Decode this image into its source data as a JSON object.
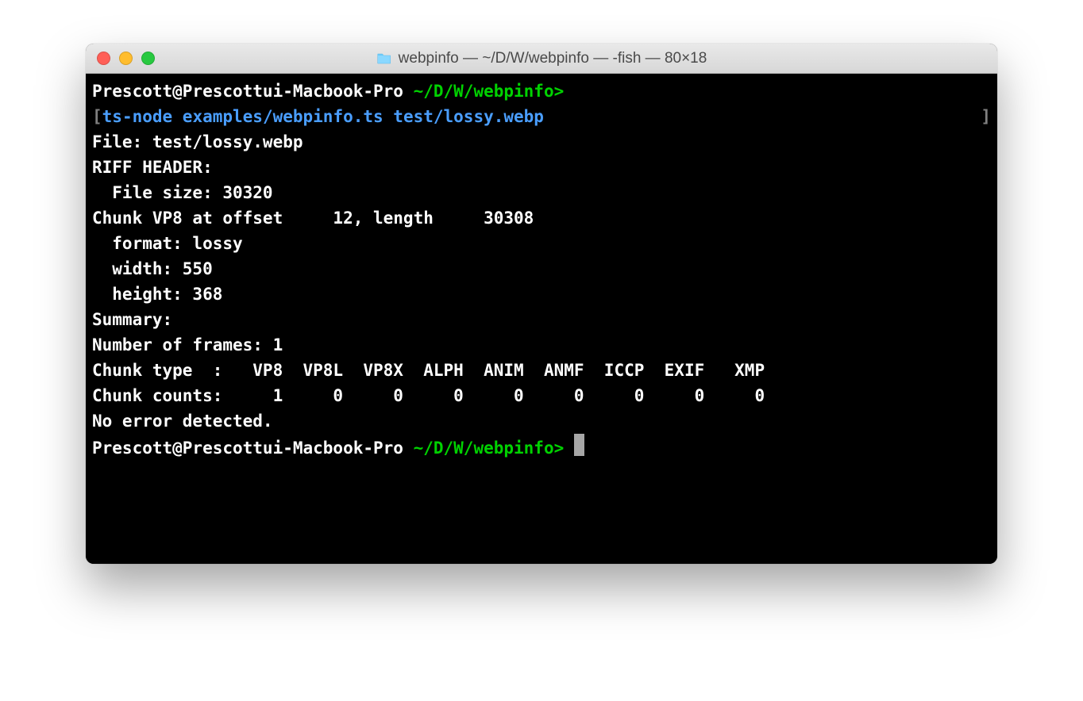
{
  "window": {
    "title": "webpinfo — ~/D/W/webpinfo — -fish — 80×18"
  },
  "prompt": {
    "user_host": "Prescott@Prescottui-Macbook-Pro",
    "path": "~/D/W/webpinfo",
    "caret": ">"
  },
  "command": {
    "open_bracket": "[",
    "close_bracket": "]",
    "text": "ts-node examples/webpinfo.ts test/lossy.webp"
  },
  "output": {
    "line1": "File: test/lossy.webp",
    "line2": "RIFF HEADER:",
    "line3": "  File size: 30320",
    "line4": "Chunk VP8 at offset     12, length     30308",
    "line5": "  format: lossy",
    "line6": "  width: 550",
    "line7": "  height: 368",
    "line8": "Summary:",
    "line9": "Number of frames: 1",
    "line10": "Chunk type  :   VP8  VP8L  VP8X  ALPH  ANIM  ANMF  ICCP  EXIF   XMP",
    "line11": "Chunk counts:     1     0     0     0     0     0     0     0     0",
    "line12": "No error detected."
  }
}
